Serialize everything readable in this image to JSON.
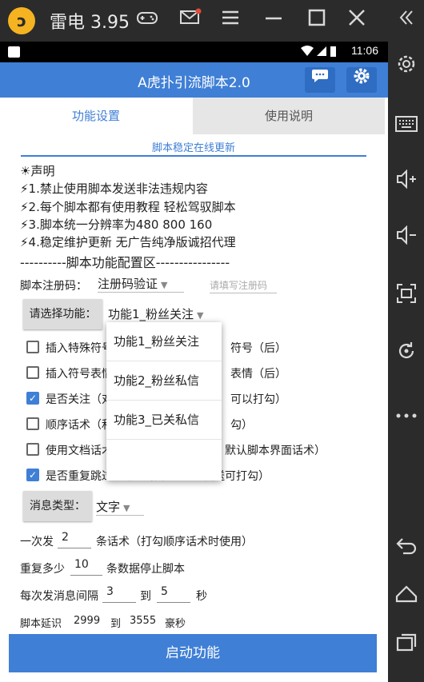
{
  "emulator": {
    "logo_glyph": "ↄ",
    "title": "雷电 3.95",
    "buttons": [
      "gamepad-icon",
      "mail-icon",
      "menu-icon",
      "minimize-icon",
      "maximize-icon",
      "close-icon"
    ],
    "sidebar_icons": [
      "collapse-icon",
      "settings-icon",
      "keyboard-icon",
      "volume-up-icon",
      "volume-down-icon",
      "fullscreen-icon",
      "rotate-icon",
      "more-icon",
      "back-icon",
      "home-icon",
      "recent-apps-icon"
    ]
  },
  "status_bar": {
    "time": "11:06"
  },
  "app": {
    "title": "A虎扑引流脚本2.0",
    "tabs": {
      "active": "功能设置",
      "inactive": "使用说明"
    },
    "notice": "脚本稳定在线更新",
    "declaration": {
      "heading": "☀声明",
      "lines": [
        "⚡1.禁止使用脚本发送非法违规内容",
        "⚡2.每个脚本都有使用教程 轻松驾驭脚本",
        "⚡3.脚本统一分辨率为480  800  160",
        "⚡4.稳定维护更新 无广告纯净版诚招代理"
      ]
    },
    "config_title": "----------脚本功能配置区----------------",
    "reg": {
      "label": "脚本注册码：",
      "select_value": "注册码验证",
      "input_placeholder": "请填写注册码"
    },
    "feature": {
      "button": "请选择功能：",
      "select_value": "功能1_粉丝关注"
    },
    "dropdown_options": [
      "功能1_粉丝关注",
      "功能2_粉丝私信",
      "功能3_已关私信"
    ],
    "checks": [
      {
        "text": "插入特殊符号",
        "tail": "符号（后）",
        "checked": false
      },
      {
        "text": "插入符号表情",
        "tail": "表情（后）",
        "checked": false
      },
      {
        "text": "是否关注（对",
        "tail": "可以打勾）",
        "checked": true
      },
      {
        "text": "顺序话术（和",
        "tail": "勾）",
        "checked": false
      },
      {
        "text": "使用文档话术（如调用文档就打勾，默认脚本界面话术）",
        "tail": "",
        "checked": false
      },
      {
        "text": "是否重复跳过（不想给某人重复发送可打勾）",
        "tail": "",
        "checked": true
      }
    ],
    "msg_type": {
      "button": "消息类型：",
      "select_value": "文字"
    },
    "send_once": {
      "prefix": "一次发",
      "value": "2",
      "suffix": "条话术（打勾顺序话术时使用）"
    },
    "repeat": {
      "prefix": "重复多少",
      "value": "10",
      "suffix": "条数据停止脚本"
    },
    "interval": {
      "prefix": "每次发消息间隔",
      "from": "3",
      "to_label": "到",
      "to": "5",
      "unit": "秒"
    },
    "delay": {
      "prefix": "脚本延识",
      "from": "2999",
      "to_label": "到",
      "to": "3555",
      "unit": "豪秒"
    },
    "start_button": "启动功能"
  },
  "colors": {
    "accent": "#3f7fd6",
    "emulator_bg": "#2b2b2b"
  }
}
